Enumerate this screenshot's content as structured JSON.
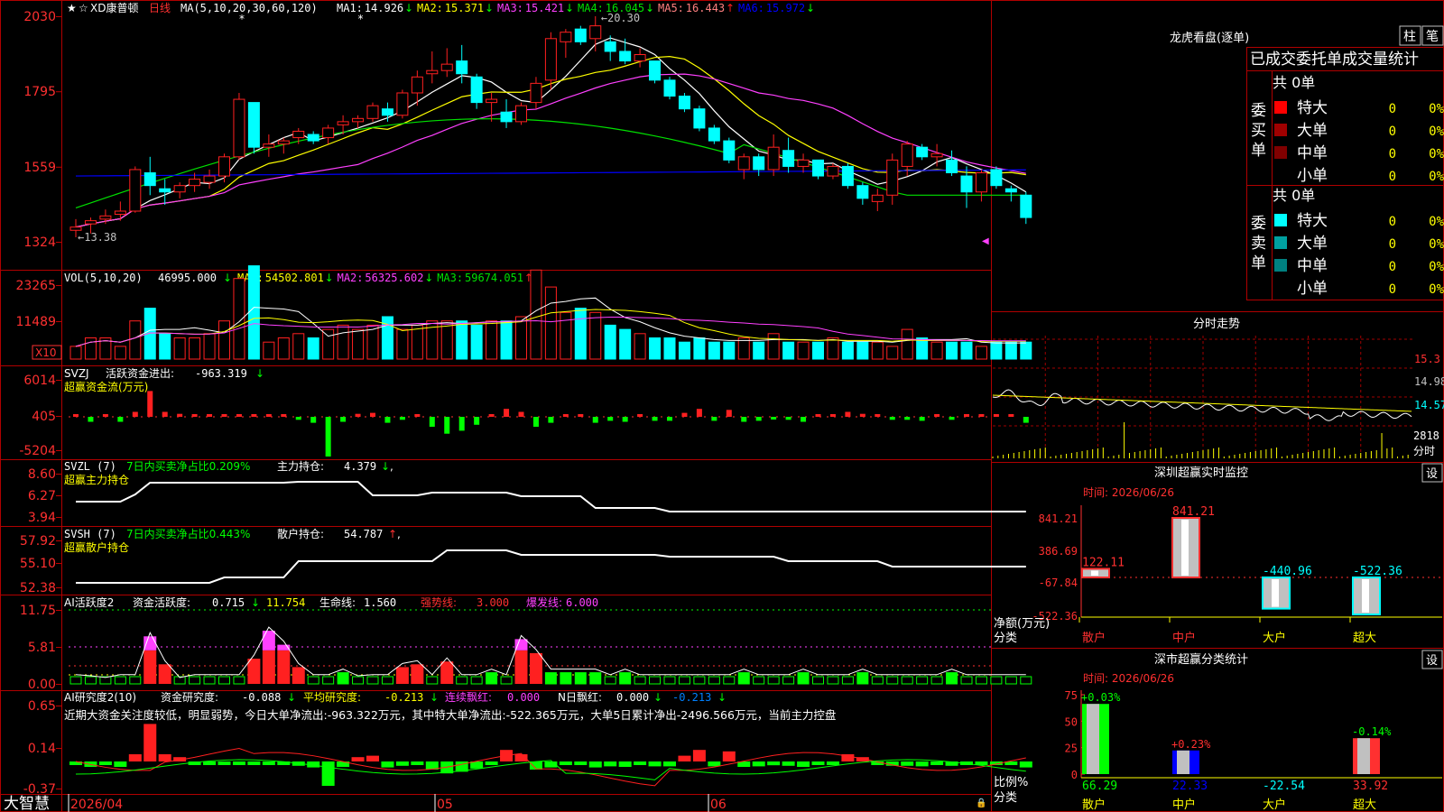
{
  "app": {
    "brand": "大智慧"
  },
  "colors": {
    "up": "#ff2020",
    "down": "#00ffff",
    "grid": "#a00000",
    "text_dim": "#c0c0c0",
    "ma1": "#ffffff",
    "ma2": "#ffff00",
    "ma3": "#ff40ff",
    "ma4": "#00e000",
    "ma5": "#ff8080",
    "ma6": "#0000ff",
    "green": "#00ff00",
    "yellow": "#ffff00",
    "axis_red": "#ff3030"
  },
  "main": {
    "stock": "XD康普顿",
    "period": "日线",
    "ma_label": "MA(5,10,20,30,60,120)",
    "ma": [
      {
        "name": "MA1:",
        "value": "14.926",
        "arrow": "↓"
      },
      {
        "name": "MA2:",
        "value": "15.371",
        "arrow": "↓"
      },
      {
        "name": "MA3:",
        "value": "15.421",
        "arrow": "↓"
      },
      {
        "name": "MA4:",
        "value": "16.045",
        "arrow": "↓"
      },
      {
        "name": "MA5:",
        "value": "16.443",
        "arrow": "↑"
      },
      {
        "name": "MA6:",
        "value": "15.972",
        "arrow": "↓"
      }
    ],
    "y_ticks": [
      "2030",
      "1795",
      "1559",
      "1324"
    ],
    "high_label": "20.30",
    "low_label": "13.38"
  },
  "chart_data": {
    "type": "candlestick",
    "x_ticks": [
      "2026/04",
      "05",
      "06"
    ],
    "ohlc": [
      [
        13.6,
        13.95,
        13.38,
        13.7
      ],
      [
        13.8,
        14.0,
        13.5,
        13.9
      ],
      [
        13.95,
        14.25,
        13.8,
        14.05
      ],
      [
        14.1,
        14.5,
        13.9,
        14.2
      ],
      [
        14.2,
        15.6,
        14.15,
        15.5
      ],
      [
        15.4,
        15.9,
        14.7,
        15.0
      ],
      [
        14.9,
        15.2,
        14.4,
        14.8
      ],
      [
        14.8,
        15.1,
        14.6,
        15.0
      ],
      [
        15.0,
        15.4,
        14.8,
        15.2
      ],
      [
        15.1,
        15.5,
        14.9,
        15.3
      ],
      [
        15.3,
        16.0,
        15.1,
        15.9
      ],
      [
        15.9,
        17.9,
        15.8,
        17.7
      ],
      [
        17.6,
        17.6,
        16.0,
        16.2
      ],
      [
        16.2,
        16.6,
        15.9,
        16.3
      ],
      [
        16.3,
        16.5,
        16.0,
        16.4
      ],
      [
        16.5,
        16.8,
        16.3,
        16.7
      ],
      [
        16.6,
        16.7,
        16.3,
        16.4
      ],
      [
        16.5,
        16.9,
        16.3,
        16.8
      ],
      [
        16.9,
        17.2,
        16.6,
        17.0
      ],
      [
        17.0,
        17.2,
        16.8,
        17.1
      ],
      [
        17.1,
        17.6,
        17.0,
        17.5
      ],
      [
        17.4,
        17.6,
        17.0,
        17.2
      ],
      [
        17.2,
        18.0,
        17.1,
        17.9
      ],
      [
        17.9,
        18.6,
        17.5,
        18.4
      ],
      [
        18.5,
        19.2,
        18.2,
        18.6
      ],
      [
        18.6,
        19.3,
        18.4,
        18.8
      ],
      [
        18.9,
        19.4,
        18.2,
        18.5
      ],
      [
        18.4,
        18.5,
        17.4,
        17.6
      ],
      [
        17.6,
        17.9,
        17.0,
        17.7
      ],
      [
        17.3,
        17.7,
        16.8,
        17.0
      ],
      [
        17.0,
        17.6,
        16.9,
        17.5
      ],
      [
        17.6,
        18.4,
        17.4,
        18.2
      ],
      [
        18.3,
        19.8,
        18.0,
        19.6
      ],
      [
        19.5,
        19.9,
        19.0,
        19.8
      ],
      [
        19.9,
        20.0,
        19.4,
        19.5
      ],
      [
        19.6,
        20.3,
        19.2,
        20.0
      ],
      [
        19.5,
        19.7,
        18.9,
        19.2
      ],
      [
        19.2,
        19.6,
        18.8,
        18.9
      ],
      [
        18.9,
        19.3,
        18.7,
        19.1
      ],
      [
        18.9,
        18.9,
        18.2,
        18.3
      ],
      [
        18.3,
        18.4,
        17.7,
        17.8
      ],
      [
        17.8,
        17.9,
        17.3,
        17.4
      ],
      [
        17.4,
        17.5,
        16.7,
        16.8
      ],
      [
        16.8,
        16.9,
        16.3,
        16.4
      ],
      [
        16.4,
        16.5,
        15.7,
        15.8
      ],
      [
        15.5,
        16.0,
        15.2,
        15.9
      ],
      [
        15.9,
        16.0,
        15.3,
        15.5
      ],
      [
        15.5,
        16.6,
        15.3,
        16.2
      ],
      [
        16.1,
        16.5,
        15.4,
        15.6
      ],
      [
        15.6,
        16.0,
        15.4,
        15.8
      ],
      [
        15.8,
        15.8,
        15.2,
        15.3
      ],
      [
        15.3,
        15.7,
        15.2,
        15.6
      ],
      [
        15.6,
        15.7,
        14.9,
        15.0
      ],
      [
        15.0,
        15.1,
        14.4,
        14.6
      ],
      [
        14.5,
        14.9,
        14.2,
        14.7
      ],
      [
        14.7,
        16.0,
        14.4,
        15.8
      ],
      [
        15.6,
        16.4,
        15.3,
        16.3
      ],
      [
        16.2,
        16.3,
        15.8,
        15.9
      ],
      [
        15.9,
        16.3,
        15.6,
        16.0
      ],
      [
        15.8,
        16.1,
        15.3,
        15.4
      ],
      [
        15.3,
        15.6,
        14.3,
        14.8
      ],
      [
        14.8,
        15.5,
        14.5,
        15.4
      ],
      [
        15.5,
        15.6,
        14.9,
        15.0
      ],
      [
        14.9,
        15.0,
        14.5,
        14.8
      ],
      [
        14.7,
        14.8,
        13.8,
        14.0
      ]
    ],
    "volume_bars": [
      3,
      5,
      5,
      3,
      9,
      12,
      6,
      5,
      5,
      6,
      9,
      19,
      22,
      4,
      5,
      6,
      5,
      7,
      8,
      7,
      8,
      10,
      7,
      8,
      9,
      9,
      9,
      8,
      9,
      9,
      10,
      21,
      17,
      11,
      12,
      11,
      8,
      7,
      6,
      5,
      5,
      4,
      5,
      4,
      4,
      5,
      4,
      6,
      4,
      4,
      4,
      5,
      4,
      4,
      4,
      3,
      7,
      5,
      4,
      4,
      4,
      3,
      4,
      4,
      4
    ],
    "flow_bars": [
      0,
      -0.5,
      0,
      -0.5,
      0.5,
      2.6,
      0.5,
      0.3,
      0,
      0,
      0,
      0,
      0,
      0,
      0,
      -0.3,
      -0.6,
      -4,
      -0.5,
      0.3,
      0.4,
      -0.6,
      -0.3,
      0,
      -1,
      -1.7,
      -1.4,
      -0.8,
      0,
      0.8,
      0.5,
      -1,
      -0.6,
      0,
      0,
      -0.6,
      -0.4,
      -0.5,
      0,
      -0.4,
      -0.4,
      0.4,
      0.8,
      -0.4,
      0.7,
      -0.5,
      -0.4,
      -0.2,
      -0.3,
      -0.5,
      0,
      0,
      0.5,
      0.3,
      0,
      -0.3,
      -0.3,
      -0.4,
      0,
      -0.3,
      0,
      0,
      0,
      0,
      -0.6
    ],
    "activity_bars": [
      1,
      0.8,
      0.5,
      1,
      1,
      8.5,
      3.5,
      0.5,
      1,
      1,
      1,
      1,
      4.5,
      9.5,
      7,
      3,
      1,
      1,
      2,
      0.8,
      1,
      1,
      3,
      3.5,
      1,
      4,
      1,
      1,
      2,
      1,
      8,
      5.5,
      2,
      2,
      2,
      2,
      1,
      2,
      1,
      1,
      1,
      1,
      1,
      1,
      1,
      2,
      1,
      1,
      1,
      2,
      1,
      1,
      1,
      2,
      1,
      1,
      1,
      1,
      1,
      2,
      1,
      1,
      1,
      1,
      1
    ]
  },
  "vol": {
    "label": "VOL(5,10,20)",
    "value": "46995.000",
    "value_arrow": "↓",
    "ma": [
      {
        "name": "MA1:",
        "value": "54502.801",
        "arrow": "↓"
      },
      {
        "name": "MA2:",
        "value": "56325.602",
        "arrow": "↓"
      },
      {
        "name": "MA3:",
        "value": "59674.051",
        "arrow": "↑"
      }
    ],
    "y_ticks": [
      "23265",
      "11489"
    ],
    "unit": "X10"
  },
  "svzj": {
    "label": "SVZJ",
    "desc": "活跃资金进出:",
    "value": "-963.319",
    "arrow": "↓",
    "sub": "超赢资金流(万元)",
    "y_ticks": [
      "6014",
      "405",
      "-5204"
    ]
  },
  "svzl": {
    "label": "SVZL (7)",
    "desc": "7日内买卖净占比0.209%",
    "hold": "主力持仓:",
    "value": "4.379",
    "arrow": "↓",
    "tail": ",",
    "sub": "超赢主力持仓",
    "y_ticks": [
      "8.60",
      "6.27",
      "3.94"
    ]
  },
  "svsh": {
    "label": "SVSH (7)",
    "desc": "7日内买卖净占比0.443%",
    "hold": "散户持仓:",
    "value": "54.787",
    "arrow": "↑",
    "tail": ",",
    "sub": "超赢散户持仓",
    "y_ticks": [
      "57.92",
      "55.10",
      "52.38"
    ]
  },
  "ai1": {
    "label": "AI活跃度2",
    "a_name": "资金活跃度:",
    "a_val": "0.715",
    "a_arrow": "↓",
    "b_val": "11.754",
    "c_name": "生命线:",
    "c_val": "1.560",
    "d_name": "强势线:",
    "d_val": "3.000",
    "e_name": "爆发线:",
    "e_val": "6.000",
    "y_ticks": [
      "11.75",
      "5.81",
      "0.00"
    ]
  },
  "ai2": {
    "label": "AI研究度2(10)",
    "a_name": "资金研究度:",
    "a_val": "-0.088",
    "a_arrow": "↓",
    "b_name": "平均研究度:",
    "b_val": "-0.213",
    "b_arrow": "↓",
    "c_name": "连续飘红:",
    "c_val": "0.000",
    "d_name": "N日飘红:",
    "d_val": "0.000",
    "d_arrow": "↓",
    "e_val": "-0.213",
    "e_arrow": "↓",
    "comment": "近期大资金关注度较低，明显弱势，今日大单净流出:-963.322万元，其中特大单净流出:-522.365万元，大单5日累计净出-2496.566万元，当前主力控盘",
    "y_ticks": [
      "0.65",
      "0.14",
      "-0.37"
    ]
  },
  "right": {
    "dragon_title": "龙虎看盘(逐单)",
    "btn_zhu": "柱",
    "btn_bi": "笔",
    "table_title": "已成交委托单成交量统计",
    "buy_label": "委买单",
    "sell_label": "委卖单",
    "buy_total": "共 0单",
    "sell_total": "共 0单",
    "rows": [
      "特大",
      "大单",
      "中单",
      "小单"
    ],
    "zero": "0",
    "pct": "0%",
    "minute_title": "分时走势",
    "minute_y": [
      "15.3",
      "14.98",
      "14.57"
    ],
    "minute_vol": "2818",
    "minute_unit": "分时",
    "sz_title": "深圳超赢实时监控",
    "set": "设",
    "sz_time": "时间: 2026/06/26",
    "sz_y": [
      "841.21",
      "386.69",
      "-67.84",
      "-522.36"
    ],
    "sz_bars": [
      {
        "cat": "散户",
        "value": "122.11",
        "v": 122.11
      },
      {
        "cat": "中户",
        "value": "841.21",
        "v": 841.21
      },
      {
        "cat": "大户",
        "value": "-440.96",
        "v": -440.96
      },
      {
        "cat": "超大",
        "value": "-522.36",
        "v": -522.36
      }
    ],
    "sz_axis_a": "净额(万元)",
    "sz_axis_b": "分类",
    "cls_title": "深市超赢分类统计",
    "cls_time": "时间: 2026/06/26",
    "cls_y": [
      "75",
      "50",
      "25",
      "0"
    ],
    "cls_bars": [
      {
        "cat": "散户",
        "pct": "+0.03%",
        "value": "66.29",
        "v": 66.29
      },
      {
        "cat": "中户",
        "pct": "+0.23%",
        "value": "22.33",
        "v": 22.33
      },
      {
        "cat": "大户",
        "pct": "",
        "value": "-22.54",
        "v": -22.54
      },
      {
        "cat": "超大",
        "pct": "-0.14%",
        "value": "33.92",
        "v": 33.92
      }
    ],
    "cls_axis_a": "比例%",
    "cls_axis_b": "分类"
  }
}
